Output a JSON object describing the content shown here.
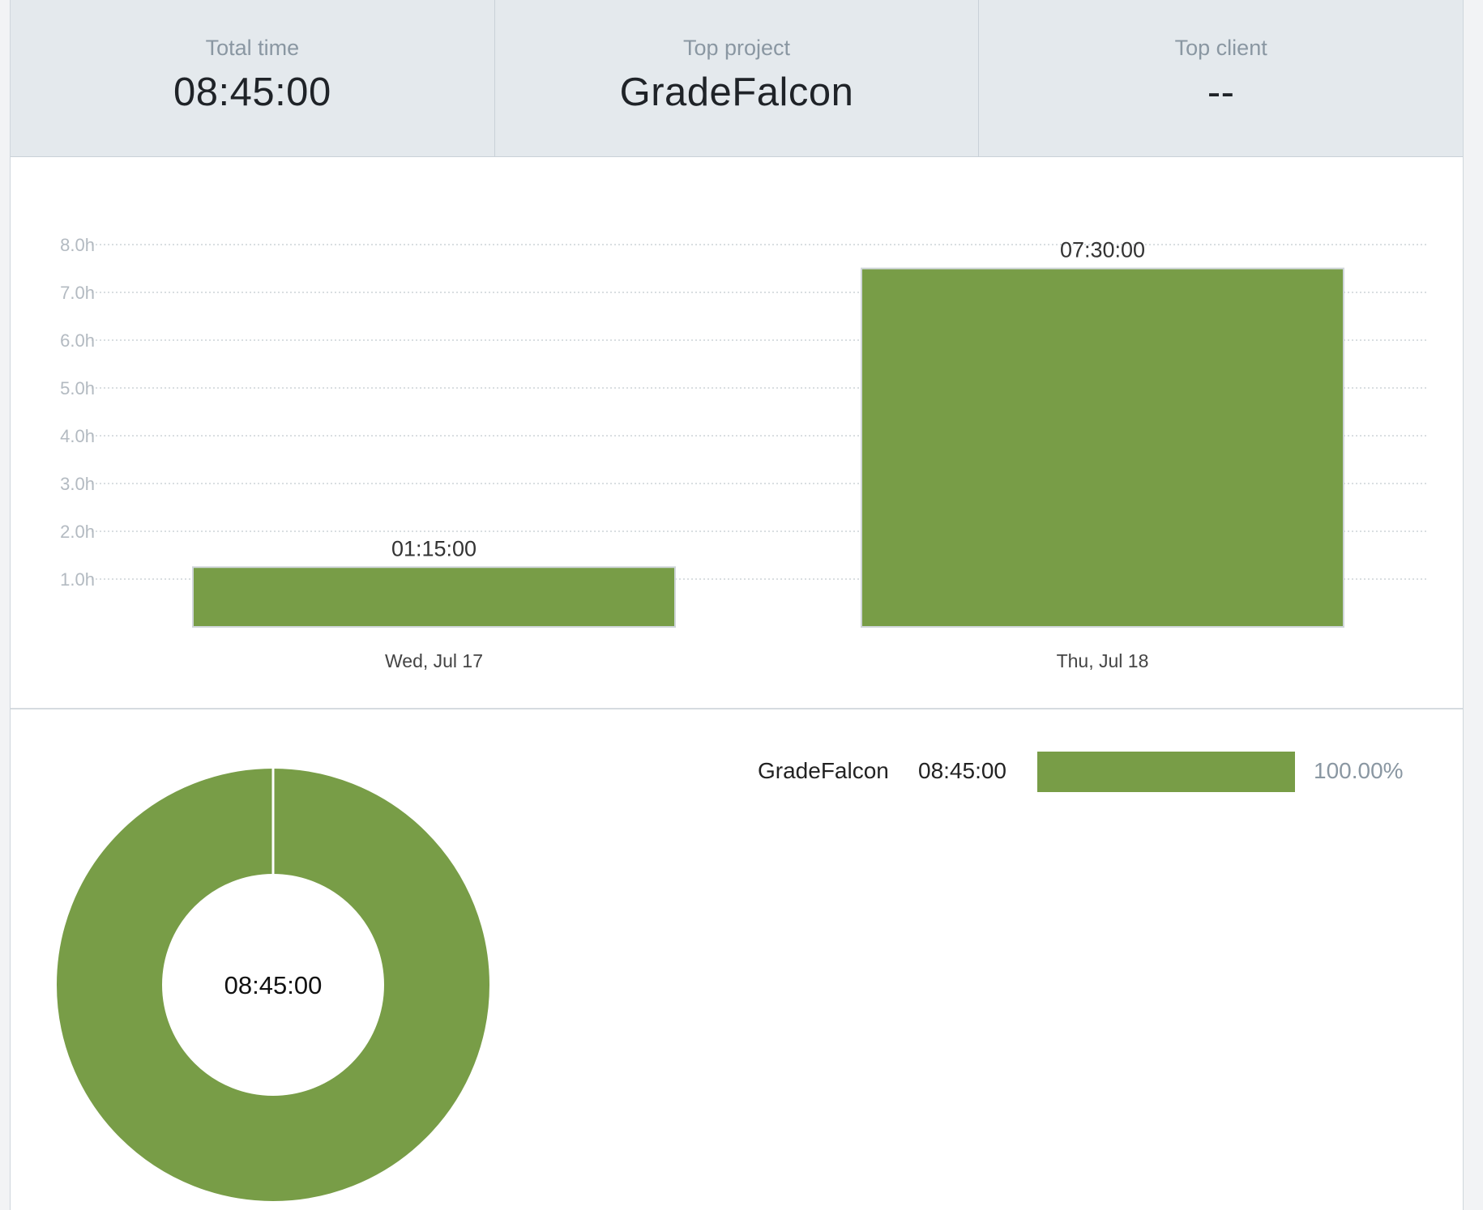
{
  "summary": {
    "cards": [
      {
        "label": "Total time",
        "value": "08:45:00"
      },
      {
        "label": "Top project",
        "value": "GradeFalcon"
      },
      {
        "label": "Top client",
        "value": "--"
      }
    ]
  },
  "colors": {
    "accent": "#789d47",
    "summary_bg": "#e4e9ed",
    "muted_text": "#8a97a2"
  },
  "chart_data": [
    {
      "type": "bar",
      "categories": [
        "Wed, Jul 17",
        "Thu, Jul 18"
      ],
      "values": [
        1.25,
        7.5
      ],
      "data_labels": [
        "01:15:00",
        "07:30:00"
      ],
      "y_ticks": [
        "1.0h",
        "2.0h",
        "3.0h",
        "4.0h",
        "5.0h",
        "6.0h",
        "7.0h",
        "8.0h"
      ],
      "ylim": [
        0,
        8
      ],
      "grid": true,
      "color": "#789d47"
    },
    {
      "type": "pie",
      "donut": true,
      "center_label": "08:45:00",
      "slices": [
        {
          "name": "GradeFalcon",
          "value": 100.0,
          "color": "#789d47"
        }
      ]
    }
  ],
  "legend": {
    "items": [
      {
        "name": "GradeFalcon",
        "time": "08:45:00",
        "percent_value": 100.0,
        "percent": "100.00%",
        "color": "#789d47"
      }
    ]
  }
}
